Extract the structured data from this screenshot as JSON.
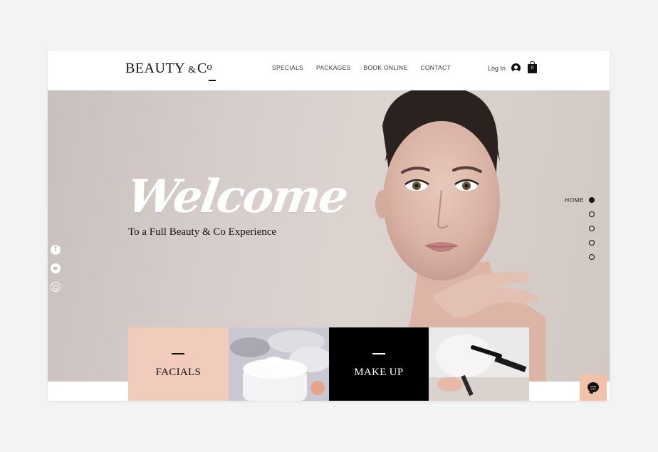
{
  "header": {
    "logo_main": "BEAUTY",
    "logo_amp": "&",
    "logo_c": "C",
    "logo_o": "o",
    "nav": [
      "SPECIALS",
      "PACKAGES",
      "BOOK ONLINE",
      "CONTACT"
    ],
    "login": "Log In",
    "cart_count": "0"
  },
  "hero": {
    "welcome": "Welcome",
    "subtitle": "To a Full Beauty & Co Experience",
    "current_section": "HOME",
    "section_dots": 5
  },
  "social": [
    "facebook-icon",
    "twitter-icon",
    "instagram-icon"
  ],
  "tiles": [
    {
      "label": "FACIALS",
      "bg": "#f1cbbb",
      "color": "#111111"
    },
    {
      "label": "",
      "bg": "#cac8d3"
    },
    {
      "label": "MAKE UP",
      "bg": "#000000",
      "color": "#ffffff"
    },
    {
      "label": "",
      "bg": "#eceae9"
    }
  ],
  "colors": {
    "accent": "#f2c1a9",
    "text": "#111111"
  }
}
